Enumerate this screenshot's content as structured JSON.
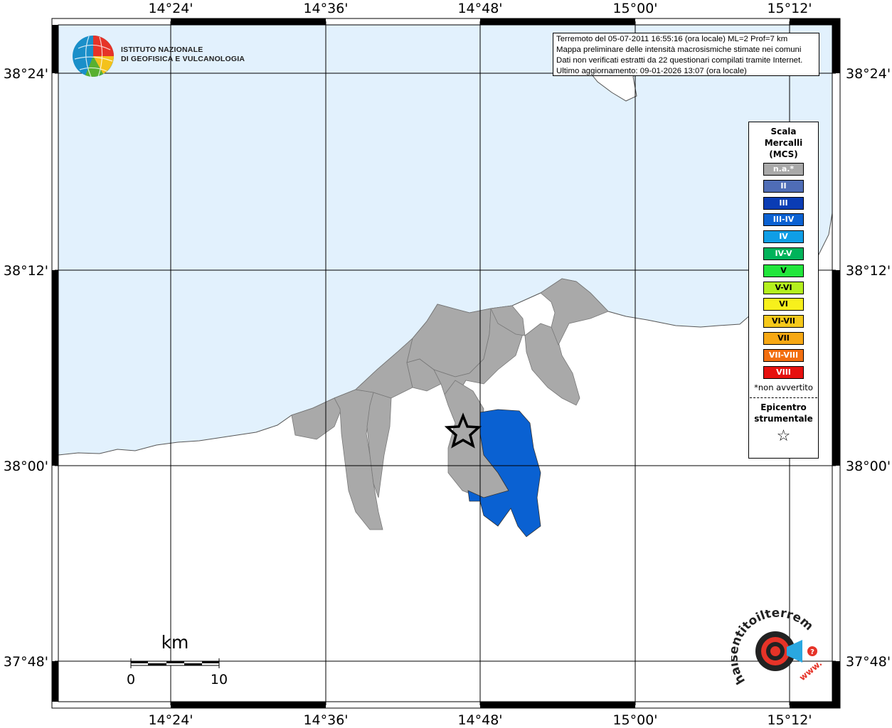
{
  "map": {
    "title_lines": [
      "Terremoto del 05-07-2011 16:55:16 (ora locale) ML=2 Prof=7 km",
      "Mappa preliminare delle intensità macrosismiche stimate nei comuni",
      "Dati non verificati estratti da 22 questionari compilati tramite Internet.",
      "Ultimo aggiornamento: 09-01-2026 13:07 (ora locale)"
    ],
    "lon_ticks": [
      "14°24'",
      "14°36'",
      "14°48'",
      "15°00'",
      "15°12'"
    ],
    "lat_ticks": [
      "38°24'",
      "38°12'",
      "38°00'",
      "37°48'"
    ],
    "colors": {
      "sea": "#e2f1fd",
      "land": "#ffffff",
      "na": "#a9a9a9",
      "intensity_III_IV": "#0a61d2",
      "grid": "#000000"
    }
  },
  "legend": {
    "title": [
      "Scala",
      "Mercalli",
      "(MCS)"
    ],
    "classes": [
      {
        "label": "n.a.*",
        "color": "#a9a9a9"
      },
      {
        "label": "II",
        "color": "#4f6db6"
      },
      {
        "label": "III",
        "color": "#0a3cb4"
      },
      {
        "label": "III-IV",
        "color": "#0a61d2"
      },
      {
        "label": "IV",
        "color": "#0f9ee6"
      },
      {
        "label": "IV-V",
        "color": "#00b35a"
      },
      {
        "label": "V",
        "color": "#22e63c"
      },
      {
        "label": "V-VI",
        "color": "#b4f01e"
      },
      {
        "label": "VI",
        "color": "#f7f01c"
      },
      {
        "label": "VI-VII",
        "color": "#f5c81a"
      },
      {
        "label": "VII",
        "color": "#f7a814"
      },
      {
        "label": "VII-VIII",
        "color": "#f26e0f"
      },
      {
        "label": "VIII",
        "color": "#e6100e"
      }
    ],
    "note": "*non avvertito",
    "epicenter_label": [
      "Epicentro",
      "strumentale"
    ],
    "star_icon": "star-outline-icon"
  },
  "scale_bar": {
    "unit": "km",
    "ticks": [
      "0",
      "10"
    ]
  },
  "logos": {
    "ingv_lines": [
      "ISTITUTO NAZIONALE",
      "DI GEOFISICA E VULCANOLOGIA"
    ],
    "hai_sentito": "haisentitoilterremoto.it",
    "hai_www": "www."
  }
}
